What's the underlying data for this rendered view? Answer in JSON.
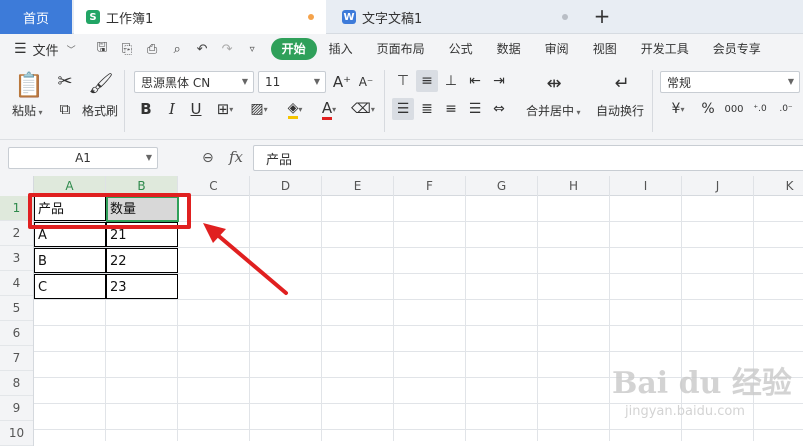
{
  "tabs": {
    "home": "首页",
    "workbook": "工作簿1",
    "document": "文字文稿1",
    "add": "+"
  },
  "menu": {
    "file": "文件",
    "items": [
      "开始",
      "插入",
      "页面布局",
      "公式",
      "数据",
      "审阅",
      "视图",
      "开发工具",
      "会员专享"
    ]
  },
  "ribbon": {
    "paste": "粘贴",
    "format_painter": "格式刷",
    "font_name": "思源黑体 CN",
    "font_size": "11",
    "merge_center": "合并居中",
    "wrap_text": "自动换行",
    "number_format": "常规",
    "currency_symbol": "¥",
    "percent_symbol": "%",
    "thousands": "000"
  },
  "formula_bar": {
    "cell_ref": "A1",
    "fx": "fx",
    "content": "产品"
  },
  "grid": {
    "columns": [
      "A",
      "B",
      "C",
      "D",
      "E",
      "F",
      "G",
      "H",
      "I",
      "J",
      "K"
    ],
    "rows": [
      "1",
      "2",
      "3",
      "4",
      "5",
      "6",
      "7",
      "8",
      "9",
      "10"
    ],
    "table": [
      [
        "产品",
        "数量"
      ],
      [
        "A",
        "21"
      ],
      [
        "B",
        "22"
      ],
      [
        "C",
        "23"
      ]
    ]
  },
  "colors": {
    "accent": "#2fa05a",
    "annotation": "#e02020",
    "home_tab": "#3d7bd9"
  }
}
